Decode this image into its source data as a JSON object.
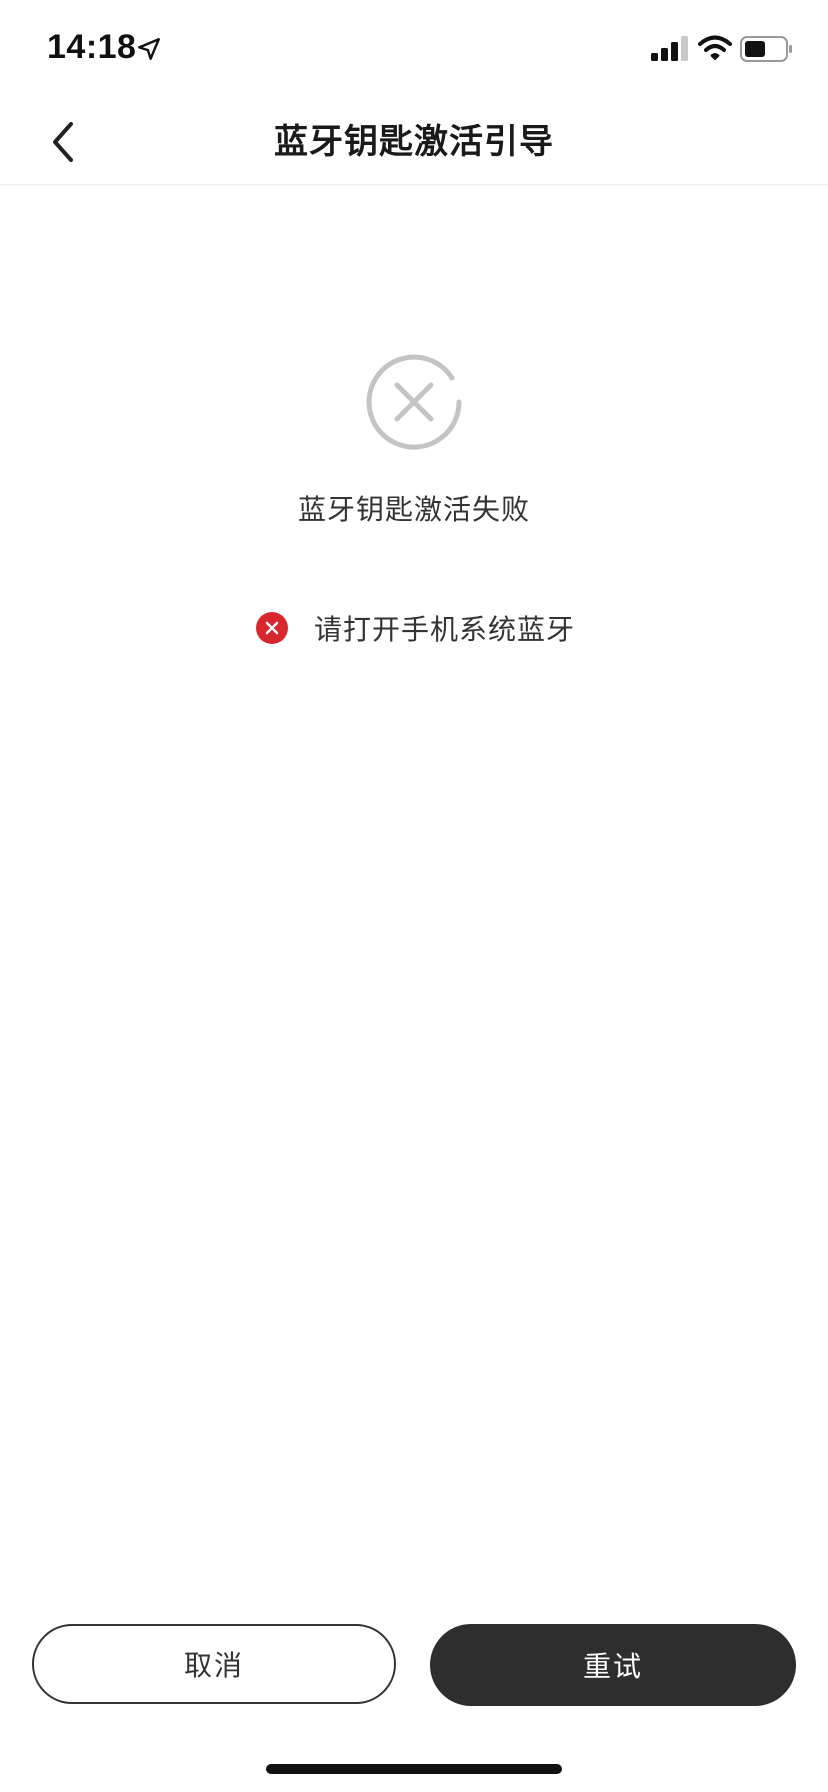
{
  "status_bar": {
    "time": "14:18",
    "icons": [
      "location-arrow-icon",
      "cellular-signal-icon",
      "wifi-icon",
      "battery-icon"
    ]
  },
  "nav": {
    "title": "蓝牙钥匙激活引导",
    "back_icon": "chevron-left-icon"
  },
  "result": {
    "icon": "circle-x-icon",
    "title": "蓝牙钥匙激活失败",
    "reason": {
      "icon": "error-badge-icon",
      "text": "请打开手机系统蓝牙"
    }
  },
  "actions": {
    "cancel_label": "取消",
    "retry_label": "重试"
  },
  "colors": {
    "error_red": "#d8282d",
    "fail_icon_gray": "#c4c4c4",
    "primary_dark": "#2e2e2e"
  }
}
